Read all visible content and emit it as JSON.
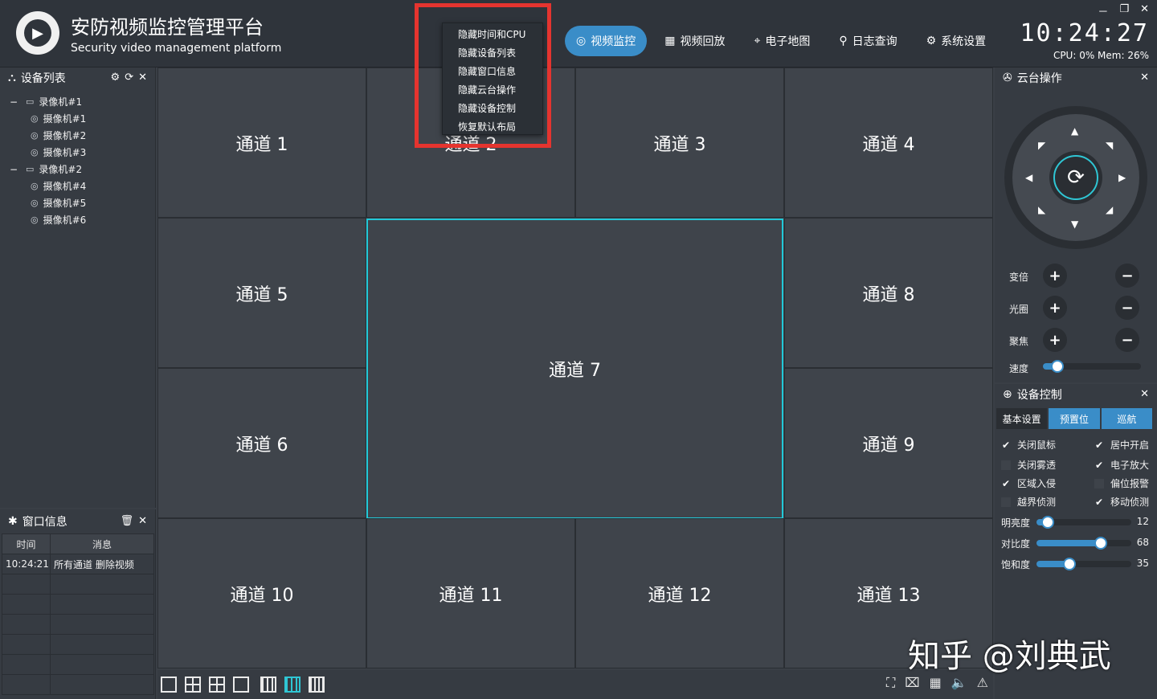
{
  "header": {
    "title": "安防视频监控管理平台",
    "subtitle": "Security video management platform",
    "clock": "10:24:27",
    "sys_stat": "CPU: 0% Mem: 26%",
    "window_controls": [
      "－",
      "❐",
      "✕"
    ]
  },
  "nav": [
    {
      "label": "视频监控",
      "icon": "camera-icon",
      "active": true
    },
    {
      "label": "视频回放",
      "icon": "film-icon",
      "active": false
    },
    {
      "label": "电子地图",
      "icon": "map-icon",
      "active": false
    },
    {
      "label": "日志查询",
      "icon": "search-icon",
      "active": false
    },
    {
      "label": "系统设置",
      "icon": "gear-icon",
      "active": false
    }
  ],
  "device_list": {
    "title": "设备列表",
    "tree": [
      {
        "label": "录像机#1",
        "children": [
          "摄像机#1",
          "摄像机#2",
          "摄像机#3"
        ]
      },
      {
        "label": "录像机#2",
        "children": [
          "摄像机#4",
          "摄像机#5",
          "摄像机#6"
        ]
      }
    ]
  },
  "window_info": {
    "title": "窗口信息",
    "columns": [
      "时间",
      "消息"
    ],
    "rows": [
      {
        "time": "10:24:21",
        "msg": "所有通道 删除视频"
      }
    ]
  },
  "channels": [
    "通道 1",
    "通道 2",
    "通道 3",
    "通道 4",
    "通道 5",
    "通道 7",
    "通道 8",
    "通道 6",
    "通道 9",
    "通道 10",
    "通道 11",
    "通道 12",
    "通道 13"
  ],
  "context_menu": [
    "隐藏时间和CPU",
    "隐藏设备列表",
    "隐藏窗口信息",
    "隐藏云台操作",
    "隐藏设备控制",
    "恢复默认布局"
  ],
  "ptz": {
    "title": "云台操作",
    "rows": [
      "变倍",
      "光圈",
      "聚焦"
    ],
    "speed_label": "速度",
    "speed_value": 0.15
  },
  "device_ctrl": {
    "title": "设备控制",
    "tabs": [
      "基本设置",
      "预置位",
      "巡航"
    ],
    "checks": [
      {
        "label": "关闭鼠标",
        "checked": true
      },
      {
        "label": "居中开启",
        "checked": true
      },
      {
        "label": "关闭雾透",
        "checked": false
      },
      {
        "label": "电子放大",
        "checked": true
      },
      {
        "label": "区域入侵",
        "checked": true
      },
      {
        "label": "偏位报警",
        "checked": false
      },
      {
        "label": "越界侦测",
        "checked": false
      },
      {
        "label": "移动侦测",
        "checked": true
      }
    ],
    "image": [
      {
        "label": "明亮度",
        "value": 12
      },
      {
        "label": "对比度",
        "value": 68
      },
      {
        "label": "饱和度",
        "value": 35
      }
    ]
  },
  "watermark": "知乎 @刘典武"
}
